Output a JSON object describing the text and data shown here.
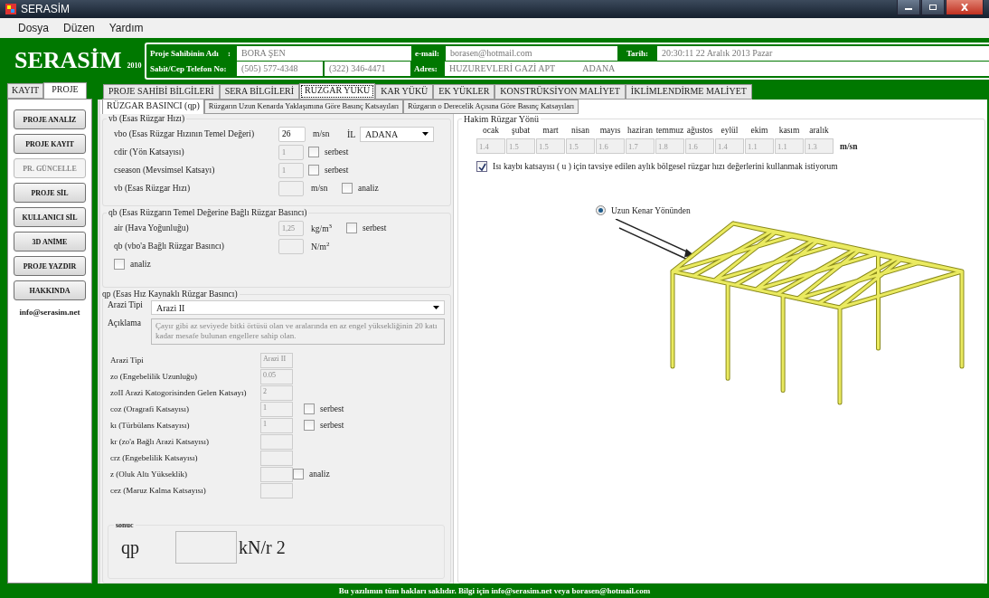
{
  "window": {
    "title": "SERASİM"
  },
  "menu": [
    "Dosya",
    "Düzen",
    "Yardım"
  ],
  "logo": {
    "name": "SERASİM",
    "year": "2010"
  },
  "header": {
    "owner_label": "Proje Sahibinin Adı",
    "owner_sep": ":",
    "owner": "BORA ŞEN",
    "phone_label": "Sabit/Cep Telefon No:",
    "phone_1": "(505) 577-4348",
    "phone_2": "(322) 346-4471",
    "email_label": "e-mail:",
    "email": "borasen@hotmail.com",
    "address_label": "Adres:",
    "address": "HUZUREVLERİ GAZİ APT",
    "city": "ADANA",
    "date_label": "Tarih:",
    "date": "20:30:11 22 Aralık 2013 Pazar"
  },
  "side_tabs": [
    {
      "label": "KAYIT",
      "selected": false
    },
    {
      "label": "PROJE",
      "selected": true
    }
  ],
  "side_buttons": [
    {
      "label": "PROJE ANALİZ",
      "disabled": false
    },
    {
      "label": "PROJE KAYIT",
      "disabled": false
    },
    {
      "label": "PR. GÜNCELLE",
      "disabled": true
    },
    {
      "label": "PROJE SİL",
      "disabled": false
    },
    {
      "label": "KULLANICI SİL",
      "disabled": false
    },
    {
      "label": "3D ANİME",
      "disabled": false
    },
    {
      "label": "PROJE YAZDIR",
      "disabled": false
    },
    {
      "label": "HAKKINDA",
      "disabled": false
    }
  ],
  "side_link": "info@serasim.net",
  "main_tabs": [
    {
      "label": "PROJE SAHİBİ BİLGİLERİ",
      "selected": false
    },
    {
      "label": "SERA BİLGİLERİ",
      "selected": false
    },
    {
      "label": "RÜZGAR YÜKÜ",
      "selected": true
    },
    {
      "label": "KAR YÜKÜ",
      "selected": false
    },
    {
      "label": "EK YÜKLER",
      "selected": false
    },
    {
      "label": "KONSTRÜKSİYON MALİYET",
      "selected": false
    },
    {
      "label": "İKLİMLENDİRME MALİYET",
      "selected": false
    }
  ],
  "sub_tabs": [
    {
      "label": "RÜZGAR BASINCI (qp)",
      "selected": true
    },
    {
      "label": "Rüzgarın Uzun Kenarda Yaklaşımına Göre Basınç Katsayıları",
      "selected": false
    },
    {
      "label": "Rüzgarın o Derecelik Açısına Göre Basınç Katsayıları",
      "selected": false
    }
  ],
  "vb_group": {
    "title": "vb (Esas Rüzgar Hızı)",
    "rows": [
      {
        "label": "vbo  (Esas Rüzgar Hızının Temel Değeri)",
        "value": "26",
        "editable": true,
        "unit": "m/sn",
        "select": {
          "label": "İL",
          "value": "ADANA"
        }
      },
      {
        "label": "cdir  (Yön Katsayısı)",
        "value": "1",
        "editable": false,
        "check": {
          "label": "serbest",
          "checked": false,
          "kind": "inline"
        }
      },
      {
        "label": "cseason (Mevsimsel Katsayı)",
        "value": "1",
        "editable": false,
        "check": {
          "label": "serbest",
          "checked": false,
          "kind": "inline"
        }
      },
      {
        "label": "vb  (Esas Rüzgar Hızı)",
        "editable": false,
        "unit": "m/sn",
        "check": {
          "label": "analiz",
          "checked": false,
          "kind": "right"
        }
      }
    ]
  },
  "qb_group": {
    "title": "qb (Esas Rüzgarın Temel Değerine Bağlı Rüzgar Basıncı)",
    "rows": [
      {
        "label": "air  (Hava Yoğunluğu)",
        "value": "1,25",
        "editable": false,
        "unit": "kg/m",
        "unit_sup": "3",
        "check": {
          "label": "serbest",
          "checked": false,
          "kind": "inline"
        }
      },
      {
        "label": "qb  (vbo'a Bağlı  Rüzgar Basıncı)",
        "editable": false,
        "unit": "N/m",
        "unit_sup": "2"
      }
    ],
    "analiz": {
      "label": "analiz",
      "checked": false
    }
  },
  "qp_group": {
    "title": "qp (Esas Hız Kaynaklı Rüzgar Basıncı)",
    "terrain": {
      "label": "Arazi Tipi",
      "value": "Arazi II"
    },
    "description": {
      "label": "Açıklama",
      "text": "Çayır gibi az seviyede bitki örtüsü olan ve aralarında en az engel yüksekliğinin 20 katı kadar mesafe bulunan engellere sahip olan."
    },
    "rows": [
      {
        "label": "Arazi Tipi",
        "value": "Arazi II",
        "editable": false
      },
      {
        "label": "zo  (Engebelilik Uzunluğu)",
        "value": "0.05",
        "editable": false
      },
      {
        "label": "zoII Arazi Katogorisinden Gelen Katsayı)",
        "value": "2",
        "editable": false
      },
      {
        "label": "coz  (Oragrafi Katsayısı)",
        "value": "1",
        "editable": false,
        "check": {
          "label": "serbest",
          "checked": false,
          "kind": "inline"
        }
      },
      {
        "label": "kı  (Türbülans Katsayısı)",
        "value": "1",
        "editable": false,
        "check": {
          "label": "serbest",
          "checked": false,
          "kind": "inline"
        }
      },
      {
        "label": "kr  (zo'a Bağlı Arazi Katsayısı)",
        "editable": false
      },
      {
        "label": "crz  (Engebelilik Katsayısı)",
        "editable": false
      },
      {
        "label": "z  (Oluk Altı Yükseklik)",
        "editable": false,
        "check": {
          "label": "analiz",
          "checked": false,
          "kind": "right"
        }
      },
      {
        "label": "cez  (Maruz Kalma Katsayısı)",
        "editable": false
      }
    ],
    "result": {
      "title": "sonuc",
      "symbol": "qp",
      "unit": "kN/r 2"
    }
  },
  "wind": {
    "title": "Hakim Rüzgar Yönü",
    "unit": "m/sn",
    "months": [
      {
        "name": "ocak",
        "value": "1.4"
      },
      {
        "name": "şubat",
        "value": "1.5"
      },
      {
        "name": "mart",
        "value": "1.5"
      },
      {
        "name": "nisan",
        "value": "1.5"
      },
      {
        "name": "mayıs",
        "value": "1.6"
      },
      {
        "name": "haziran",
        "value": "1.7"
      },
      {
        "name": "temmuz",
        "value": "1.8"
      },
      {
        "name": "ağustos",
        "value": "1.6"
      },
      {
        "name": "eylül",
        "value": "1.4"
      },
      {
        "name": "ekim",
        "value": "1.1"
      },
      {
        "name": "kasım",
        "value": "1.1"
      },
      {
        "name": "aralık",
        "value": "1.3"
      }
    ],
    "use_recommended": {
      "label": "Isı kaybı katsayısı ( u ) için tavsiye edilen aylık bölgesel rüzgar hızı değerlerini kullanmak istiyorum",
      "checked": true
    },
    "direction": {
      "label": "Uzun Kenar Yönünden",
      "selected": true
    }
  },
  "footer": "Bu yazılımın tüm hakları saklıdır. Bilgi için info@serasim.net veya borasen@hotmail.com"
}
